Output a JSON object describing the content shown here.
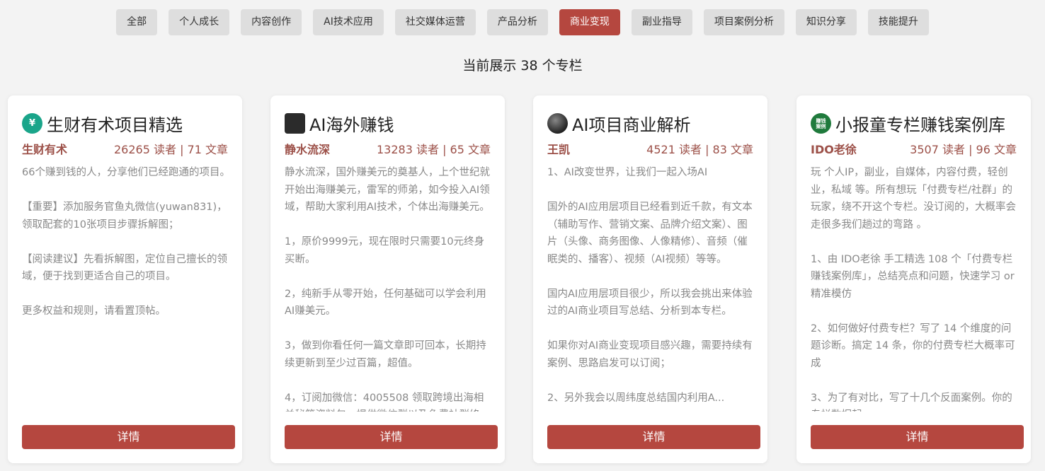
{
  "tabs": [
    "全部",
    "个人成长",
    "内容创作",
    "AI技术应用",
    "社交媒体运营",
    "产品分析",
    "商业变现",
    "副业指导",
    "项目案例分析",
    "知识分享",
    "技能提升"
  ],
  "active_tab": "商业变现",
  "count_text": "当前展示 38 个专栏",
  "detail_label": "详情",
  "cards": [
    {
      "icon": "yuan-coin-icon",
      "avatar_text": "¥",
      "title": "生财有术项目精选",
      "author": "生财有术",
      "stats": "26265 读者 | 71 文章",
      "description": "66个赚到钱的人，分享他们已经跑通的项目。\n\n【重要】添加服务官鱼丸微信(yuwan831)，领取配套的10张项目步骤拆解图；\n\n【阅读建议】先看拆解图，定位自己擅长的领域，便于找到更适合自己的项目。\n\n更多权益和规则，请看置顶帖。"
    },
    {
      "icon": "portrait-icon",
      "avatar_text": "",
      "title": "AI海外赚钱",
      "author": "静水流深",
      "stats": "13283 读者 | 65 文章",
      "description": "静水流深，国外赚美元的奠基人，上个世纪就开始出海赚美元，雷军的师弟，如今投入AI领域，帮助大家利用AI技术，个体出海赚美元。\n\n1，原价9999元，现在限时只需要10元终身买断。\n\n2，纯新手从零开始，任何基础可以学会利用AI赚美元。\n\n3，做到你看任何一篇文章即可回本，长期持续更新到至少过百篇，超值。\n\n4，订阅加微信：4005508 领取跨境出海相关秘籍资料包，提供微信群以及免费社群终..."
    },
    {
      "icon": "globe-icon",
      "avatar_text": "",
      "title": "AI项目商业解析",
      "author": "王凯",
      "stats": "4521 读者 | 83 文章",
      "description": "1、AI改变世界，让我们一起入场AI\n\n国外的AI应用层项目已经看到近千款，有文本（辅助写作、营销文案、品牌介绍文案）、图片（头像、商务图像、人像精修）、音频（催眠类的、播客）、视频（AI视频）等等。\n\n国内AI应用层项目很少，所以我会挑出来体验过的AI商业项目写总结、分析到本专栏。\n\n如果你对AI商业变现项目感兴趣，需要持续有案例、思路启发可以订阅；\n\n2、另外我会以周纬度总结国内利用A..."
    },
    {
      "icon": "brand-logo-icon",
      "avatar_text": "赚钱\n案例",
      "title": "小报童专栏赚钱案例库",
      "author": "IDO老徐",
      "stats": "3507 读者 | 96 文章",
      "description": "玩 个人IP，副业，自媒体，内容付费，轻创业，私域 等。所有想玩「付费专栏/社群」的玩家，绕不开这个专栏。没订阅的，大概率会走很多我们趟过的弯路 。\n\n1、由 IDO老徐 手工精选 108 个「付费专栏赚钱案例库」，总结亮点和问题，快速学习 or 精准模仿\n\n2、如何做好付费专栏？写了 14 个维度的问题诊断。搞定 14 条，你的付费专栏大概率可成\n\n3、为了有对比，写了十几个反面案例。你的专栏数据起..."
    }
  ]
}
